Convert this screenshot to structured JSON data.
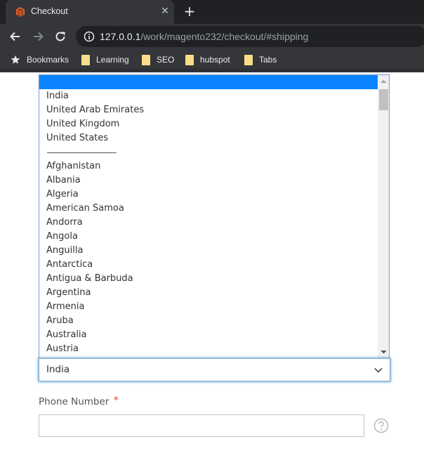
{
  "browser": {
    "tab": {
      "title": "Checkout",
      "favicon": "magento-logo-icon",
      "close_glyph": "✕"
    },
    "new_tab_glyph": "+",
    "nav": {
      "back": "back-arrow-icon",
      "forward": "forward-arrow-icon",
      "reload": "reload-icon"
    },
    "url": {
      "host": "127.0.0.1",
      "path": "/work/magento232/checkout/#shipping"
    },
    "bookmarks": [
      {
        "label": "Bookmarks",
        "icon": "star-icon"
      },
      {
        "label": "Learning",
        "icon": "folder-icon"
      },
      {
        "label": "SEO",
        "icon": "folder-icon"
      },
      {
        "label": "hubspot",
        "icon": "folder-icon"
      },
      {
        "label": "Tabs",
        "icon": "folder-icon"
      }
    ]
  },
  "country_list": {
    "selected_index": 0,
    "options": [
      "",
      "India",
      "United Arab Emirates",
      "United Kingdom",
      "United States",
      "——————————",
      "Afghanistan",
      "Albania",
      "Algeria",
      "American Samoa",
      "Andorra",
      "Angola",
      "Anguilla",
      "Antarctica",
      "Antigua & Barbuda",
      "Argentina",
      "Armenia",
      "Aruba",
      "Australia",
      "Austria"
    ],
    "separator_index": 5
  },
  "country_select": {
    "value": "India"
  },
  "phone": {
    "label": "Phone Number",
    "required_mark": "*",
    "value": "",
    "help_icon": "question-circle-icon"
  },
  "colors": {
    "selection": "#0a84ff",
    "required": "#e02b27",
    "chrome_dark": "#202124",
    "chrome": "#35363a"
  }
}
